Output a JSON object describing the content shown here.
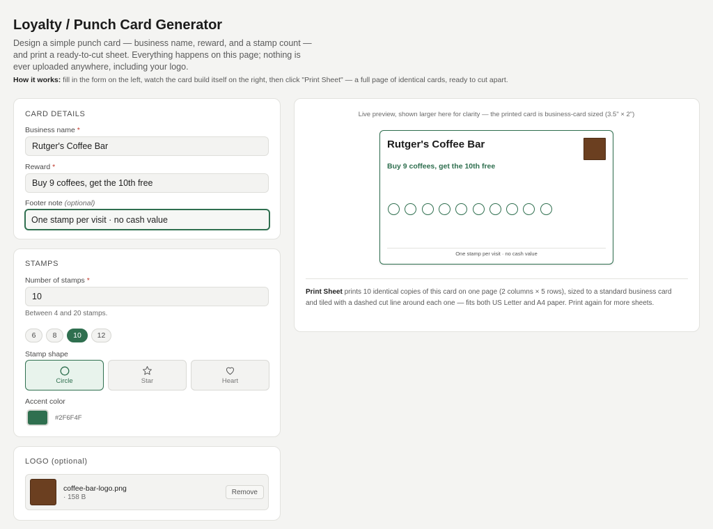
{
  "page": {
    "title": "Loyalty / Punch Card Generator",
    "description": "Design a simple punch card — business name, reward, and a stamp count — and print a ready-to-cut sheet. Everything happens on this page; nothing is ever uploaded anywhere, including your logo.",
    "how_label": "How it works:",
    "how_text": " fill in the form on the left, watch the card build itself on the right, then click \"Print Sheet\" — a full page of identical cards, ready to cut apart."
  },
  "card_details": {
    "section_title": "CARD DETAILS",
    "business_label": "Business name",
    "business_value": "Rutger's Coffee Bar",
    "reward_label": "Reward",
    "reward_value": "Buy 9 coffees, get the 10th free",
    "footer_label": "Footer note",
    "footer_optional": "(optional)",
    "footer_value": "One stamp per visit · no cash value",
    "required_mark": "*"
  },
  "stamps": {
    "section_title": "STAMPS",
    "count_label": "Number of stamps",
    "count_value": "10",
    "count_hint": "Between 4 and 20 stamps.",
    "presets": [
      "6",
      "8",
      "10",
      "12"
    ],
    "active_preset": "10",
    "shape_label": "Stamp shape",
    "shapes": {
      "circle": "Circle",
      "star": "Star",
      "heart": "Heart"
    },
    "active_shape": "Circle",
    "accent_label": "Accent color",
    "accent_hex": "#2F6F4F"
  },
  "logo": {
    "section_title": "LOGO (optional)",
    "filename": "coffee-bar-logo.png",
    "filesize": "· 158 B",
    "remove_label": "Remove"
  },
  "preview": {
    "note": "Live preview, shown larger here for clarity — the printed card is business-card sized (3.5\" × 2\")",
    "card_name": "Rutger's Coffee Bar",
    "card_reward": "Buy 9 coffees, get the 10th free",
    "card_footer": "One stamp per visit · no cash value",
    "stamp_count": 10,
    "print_label": "Print Sheet",
    "print_text": " prints 10 identical copies of this card on one page (2 columns × 5 rows), sized to a standard business card and tiled with a dashed cut line around each one — fits both US Letter and A4 paper. Print again for more sheets."
  },
  "colors": {
    "accent": "#2F6F4F",
    "logo_brown": "#6B3F20",
    "required": "#C0392B"
  }
}
